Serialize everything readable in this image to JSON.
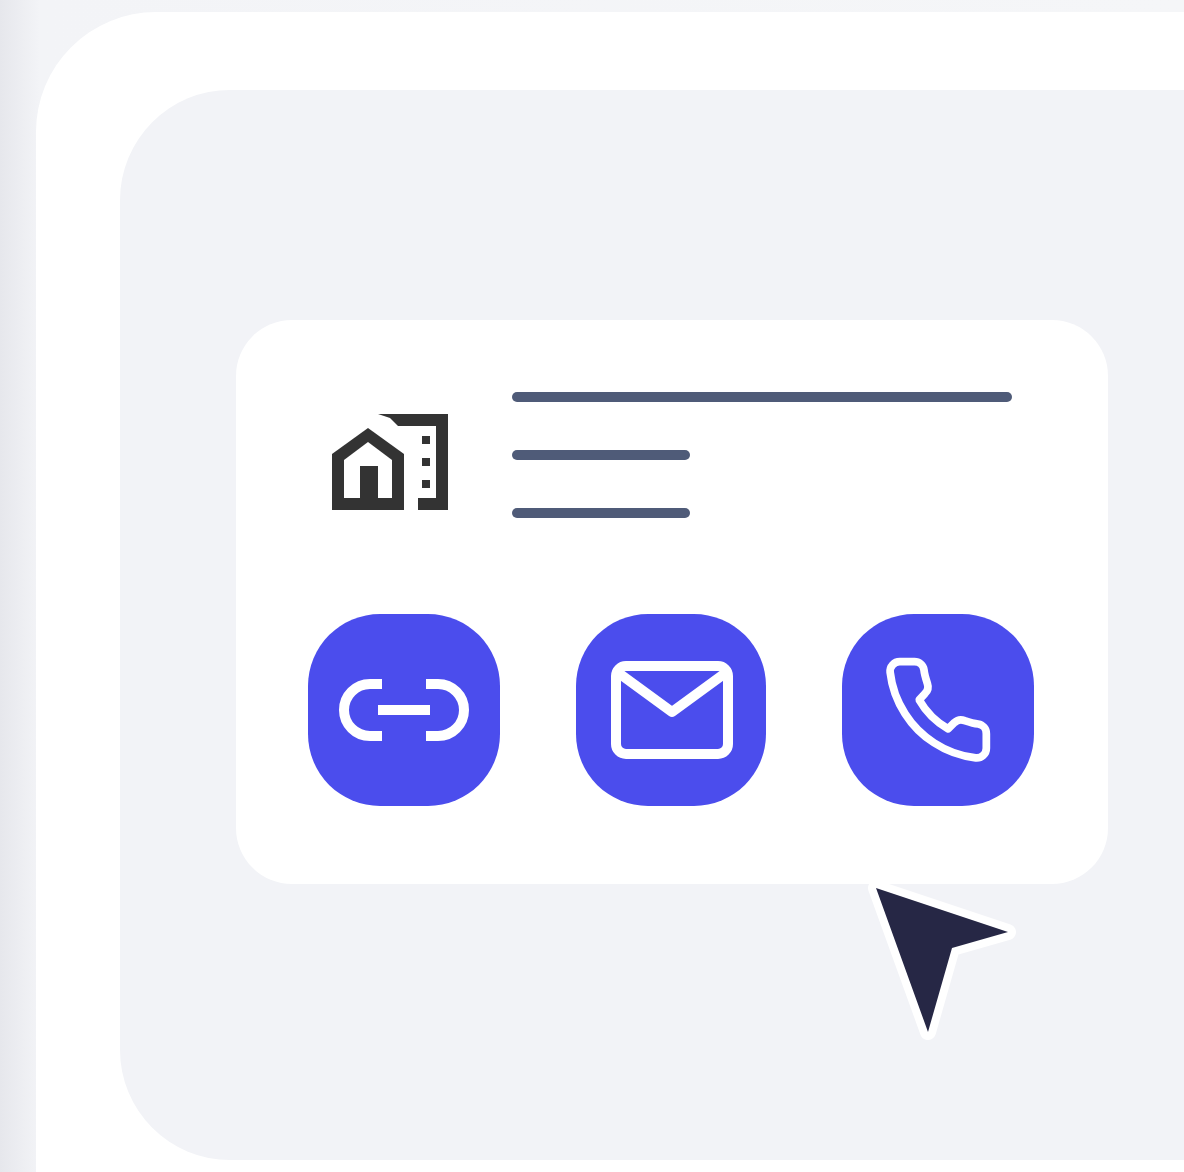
{
  "contact_card": {
    "buttons": [
      {
        "kind": "link"
      },
      {
        "kind": "email"
      },
      {
        "kind": "phone"
      }
    ]
  }
}
